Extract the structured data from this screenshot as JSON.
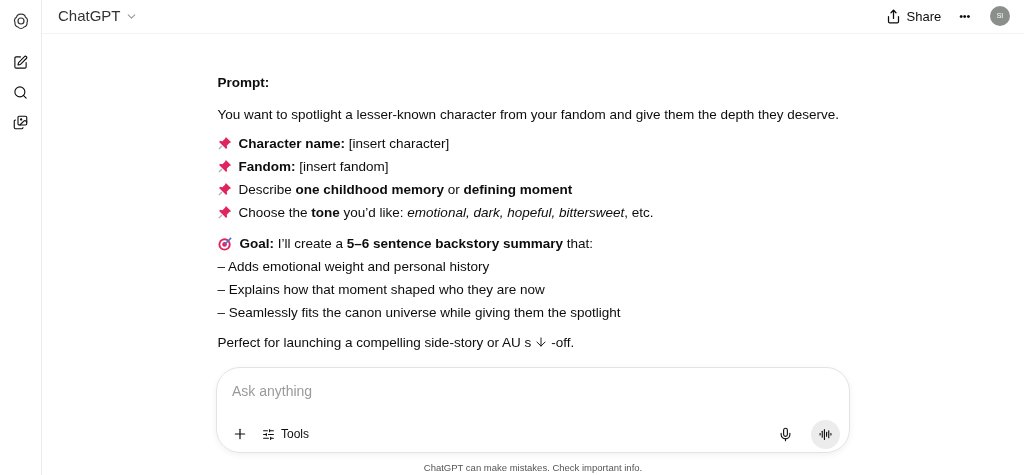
{
  "header": {
    "title": "ChatGPT",
    "share": "Share",
    "more": "•••",
    "avatar": "SI"
  },
  "message": {
    "heading": "Prompt:",
    "intro": "You want to spotlight a lesser-known character from your fandom and give them the depth they deserve.",
    "bullets": [
      "**Character name:** [insert character]",
      "**Fandom:** [insert fandom]",
      "Describe **one childhood memory** or **defining moment**",
      "Choose the **tone** you’d like: *emotional, dark, hopeful, bittersweet*, etc."
    ],
    "goal": "**Goal:** I’ll create a **5–6 sentence backstory summary** that:",
    "goal_lines": [
      "– Adds emotional weight and personal history",
      "– Explains how that moment shaped who they are now",
      "– Seamlessly fits the canon universe while giving them the spotlight"
    ],
    "closing_before": "Perfect for launching a compelling side-story or AU s",
    "closing_after": "-off."
  },
  "composer": {
    "placeholder": "Ask anything",
    "tools": "Tools"
  },
  "disclaimer": "ChatGPT can make mistakes. Check important info."
}
